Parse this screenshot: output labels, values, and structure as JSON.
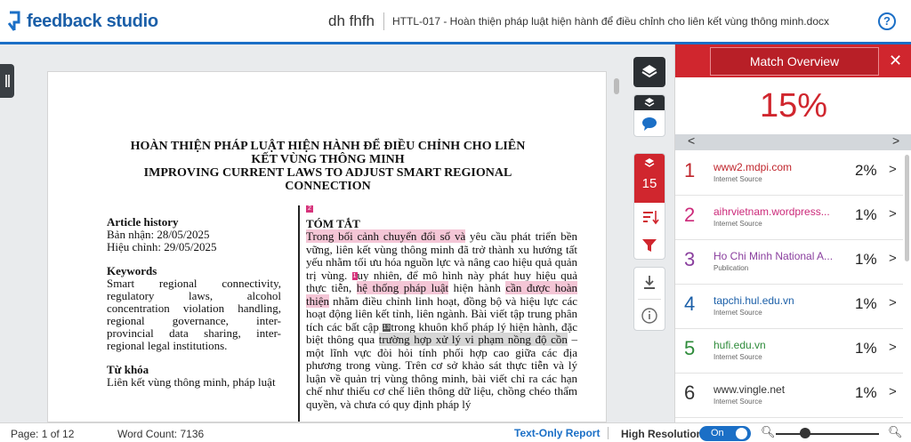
{
  "header": {
    "logo_text": "feedback studio",
    "author": "dh fhfh",
    "doc_title": "HTTL-017 - Hoàn thiện pháp luật hiện hành để điều chỉnh cho liên kết vùng thông minh.docx",
    "help_label": "?"
  },
  "document": {
    "heading_lines": [
      "HOÀN THIỆN PHÁP LUẬT HIỆN HÀNH ĐỂ ĐIỀU CHỈNH CHO LIÊN",
      "KẾT VÙNG THÔNG MINH",
      "IMPROVING CURRENT LAWS TO ADJUST SMART REGIONAL",
      "CONNECTION"
    ],
    "article_history_title": "Article history",
    "received": "Bản nhận: 28/05/2025",
    "revised": "Hiệu chỉnh: 29/05/2025",
    "keywords_title": "Keywords",
    "keywords_lines": [
      "Smart regional connectivity,",
      "regulatory laws, alcohol",
      "concentration violation handling,",
      "regional governance, inter-",
      "provincial data sharing, inter-"
    ],
    "keywords_last": "regional legal institutions.",
    "tukhoa_title": "Từ khóa",
    "tukhoa_line": "Liên kết vùng thông minh, pháp luật",
    "abstract_badge": "2",
    "abstract_title": "TÓM TẮT",
    "abs": {
      "p1_hl": "Trong bối cảnh chuyển đổi số và",
      "p1": " yêu cầu phát triển bền vững, liên kết vùng thông minh đã trở thành xu hướng tất yếu nhằm tối ưu hóa nguồn lực và nâng cao hiệu quả quản trị vùng. ",
      "badge_a": "1",
      "p2": "uy nhiên, để mô hình này phát huy hiệu quả thực tiễn, ",
      "p2_hl": "hệ thống pháp luật",
      "p3": " hiện hành ",
      "p3_hl": "cần được hoàn thiện",
      "p4": " nhằm điều chỉnh linh hoạt, đồng bộ và hiệu lực các hoạt động liên kết tỉnh, liên ngành. Bài viết tập trung phân tích các bất cập ",
      "badge_b": "13",
      "p5": "trong khuôn khổ pháp lý hiện hành, đặc biệt thông qua ",
      "p5_hl": "trường hợp xử lý vi phạm nồng độ cồn",
      "p6": " – một lĩnh vực đòi hỏi tính phối hợp cao giữa các địa phương trong vùng. Trên cơ sở khảo sát thực tiễn và lý luận về quản trị vùng thông minh, bài viết chỉ ra các hạn chế như thiếu cơ chế liên thông dữ liệu, chồng chéo thẩm quyền, và chưa có quy định pháp lý"
    }
  },
  "tools": {
    "layers_count": "15"
  },
  "panel": {
    "title": "Match Overview",
    "close": "✕",
    "overall": "15%",
    "matches": [
      {
        "num": "1",
        "source": "www2.mdpi.com",
        "type": "Internet Source",
        "pct": "2%",
        "color": "#c0262d"
      },
      {
        "num": "2",
        "source": "aihrvietnam.wordpress...",
        "type": "Internet Source",
        "pct": "1%",
        "color": "#cc2a7a"
      },
      {
        "num": "3",
        "source": "Ho Chi Minh National A...",
        "type": "Publication",
        "pct": "1%",
        "color": "#8a3f9e"
      },
      {
        "num": "4",
        "source": "tapchi.hul.edu.vn",
        "type": "Internet Source",
        "pct": "1%",
        "color": "#1b5fa8"
      },
      {
        "num": "5",
        "source": "hufi.edu.vn",
        "type": "Internet Source",
        "pct": "1%",
        "color": "#2e8b3a"
      },
      {
        "num": "6",
        "source": "www.vingle.net",
        "type": "Internet Source",
        "pct": "1%",
        "color": "#333333"
      }
    ]
  },
  "footer": {
    "page": "Page: 1 of 12",
    "word_count": "Word Count: 7136",
    "text_only": "Text-Only Report",
    "high_res": "High Resolution",
    "toggle": "On"
  },
  "icons": {
    "logo": "feedback-studio-logo-icon",
    "layers": "layers-icon",
    "comment": "comment-icon",
    "filter": "filter-icon",
    "download": "download-icon",
    "info": "info-icon",
    "zoom_out": "zoom-out-icon",
    "zoom_in": "zoom-in-icon"
  },
  "colors": {
    "brand_blue": "#1b6fc6",
    "match_red": "#d0262e",
    "highlight_pink": "#f4c6d6"
  }
}
